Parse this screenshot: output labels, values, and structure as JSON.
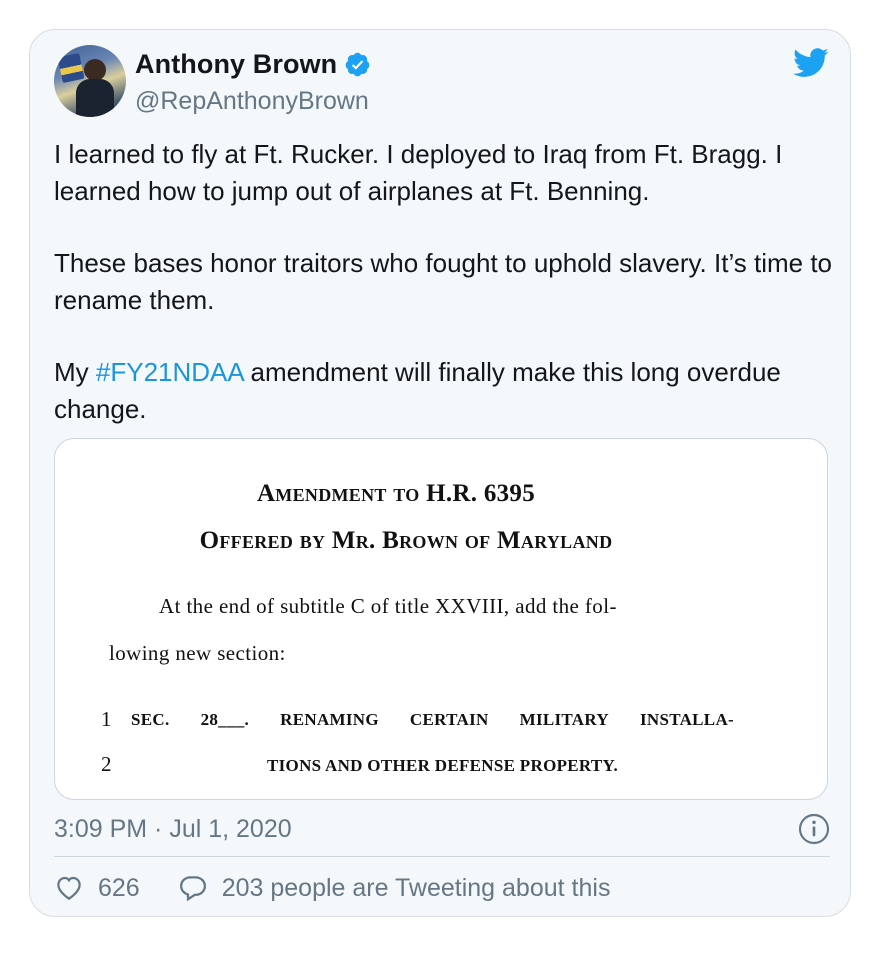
{
  "tweet": {
    "author_name": "Anthony Brown",
    "author_handle": "@RepAnthonyBrown",
    "verified": true,
    "paragraph_1": "I learned to fly at Ft. Rucker. I deployed to Iraq from Ft. Bragg. I learned how to jump out of airplanes at Ft. Benning.",
    "paragraph_2": "These bases honor traitors who fought to uphold slavery. It’s time to rename them.",
    "paragraph_3_prefix": "My ",
    "hashtag": "#FY21NDAA",
    "paragraph_3_suffix": " amendment will finally make this long overdue change.",
    "timestamp": "3:09 PM · Jul 1, 2020",
    "likes_count": "626",
    "tweeting_text": "203 people are Tweeting about this"
  },
  "document": {
    "title_line_1": "Amendment to H.R. 6395",
    "title_line_2": "Offered by Mr. Brown of Maryland",
    "body_line_1": "At the end of subtitle C of title XXVIII, add the fol-",
    "body_line_2": "lowing new section:",
    "line_number_1": "1",
    "line_number_2": "2",
    "section_words": [
      "SEC.",
      "28___.",
      "RENAMING",
      "CERTAIN",
      "MILITARY",
      "INSTALLA-"
    ],
    "section_line_2": "TIONS AND OTHER DEFENSE PROPERTY."
  },
  "icons": {
    "verified": "verified-badge-icon",
    "twitter": "twitter-bird-icon",
    "info": "info-icon",
    "like": "heart-icon",
    "reply": "speech-bubble-icon"
  },
  "colors": {
    "card_background": "#f5f8fa",
    "hashtag": "#1b95e0",
    "verified": "#1da1f2",
    "twitter_bird": "#1da1f2",
    "secondary_text": "#657786"
  }
}
